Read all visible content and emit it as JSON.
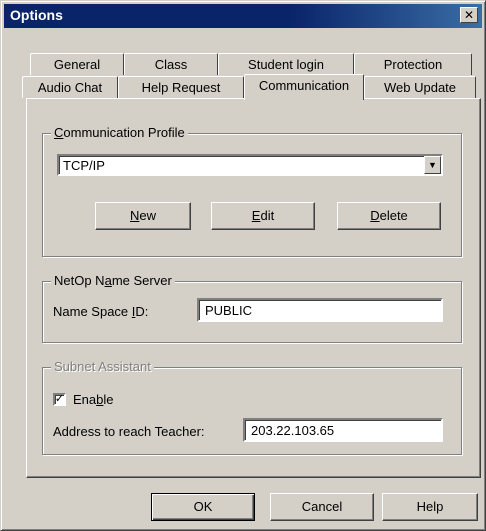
{
  "window": {
    "title": "Options",
    "close_glyph": "✕"
  },
  "tabs_row1": [
    {
      "label": "General"
    },
    {
      "label": "Class"
    },
    {
      "label": "Student login"
    },
    {
      "label": "Protection"
    }
  ],
  "tabs_row2": [
    {
      "label": "Audio Chat"
    },
    {
      "label": "Help Request"
    },
    {
      "label": "Communication",
      "active": true
    },
    {
      "label": "Web Update"
    }
  ],
  "communication_profile": {
    "legend_pre": "",
    "legend_u": "C",
    "legend_post": "ommunication Profile",
    "selected": "TCP/IP",
    "arrow_icon": "chevron-down-icon",
    "new_pre": "",
    "new_u": "N",
    "new_post": "ew",
    "edit_pre": "",
    "edit_u": "E",
    "edit_post": "dit",
    "delete_pre": "",
    "delete_u": "D",
    "delete_post": "elete"
  },
  "name_server": {
    "legend_pre": "NetOp N",
    "legend_u": "a",
    "legend_post": "me Server",
    "label_pre": "Name Space ",
    "label_u": "I",
    "label_post": "D:",
    "value": "PUBLIC"
  },
  "subnet_assistant": {
    "legend": "Subnet Assistant",
    "enable_pre": "Ena",
    "enable_u": "b",
    "enable_post": "le",
    "enable_checked": true,
    "check_glyph": "✓",
    "address_label": "Address to reach Teacher:",
    "address_value": "203.22.103.65"
  },
  "buttons": {
    "ok": "OK",
    "cancel": "Cancel",
    "help": "Help"
  },
  "colors": {
    "face": "#d4d0c8",
    "title_bar": "#0a246a",
    "disabled_text": "#808080"
  }
}
